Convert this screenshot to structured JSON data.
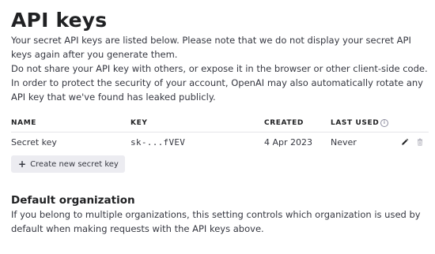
{
  "header": {
    "title": "API keys"
  },
  "intro": {
    "paragraph1": "Your secret API keys are listed below. Please note that we do not display your secret API keys again after you generate them.",
    "paragraph2": "Do not share your API key with others, or expose it in the browser or other client-side code. In order to protect the security of your account, OpenAI may also automatically rotate any API key that we've found has leaked publicly."
  },
  "keys_table": {
    "columns": {
      "name": "NAME",
      "key": "KEY",
      "created": "CREATED",
      "last_used": "LAST USED"
    },
    "rows": [
      {
        "name": "Secret key",
        "key": "sk-...fVEV",
        "created": "4 Apr 2023",
        "last_used": "Never"
      }
    ],
    "icons": {
      "last_used_info": "info-icon",
      "edit": "pencil-icon",
      "delete": "trash-icon"
    }
  },
  "actions": {
    "create_label": "Create new secret key",
    "create_icon": "plus-icon"
  },
  "default_org": {
    "title": "Default organization",
    "description": "If you belong to multiple organizations, this setting controls which organization is used by default when making requests with the API keys above."
  },
  "colors": {
    "text": "#353740",
    "heading": "#202123",
    "button_bg": "#ececf1",
    "divider": "#e5e5e9"
  }
}
